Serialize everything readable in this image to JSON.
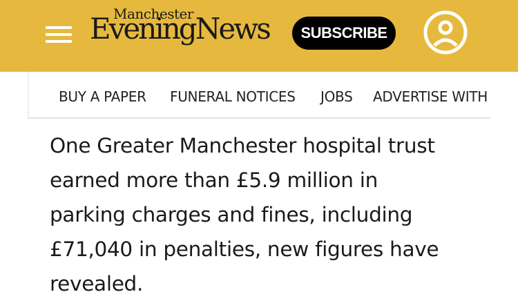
{
  "header": {
    "background_color": "#e6b93e",
    "menu_icon": "hamburger-menu-icon",
    "logo": {
      "top_text": "Manchester",
      "main_text": "EveningNews"
    },
    "subscribe_label": "SUBSCRIBE",
    "account_icon": "user-account-icon"
  },
  "nav": {
    "items": [
      {
        "label": "BUY A PAPER"
      },
      {
        "label": "FUNERAL NOTICES"
      },
      {
        "label": "JOBS"
      },
      {
        "label": "ADVERTISE WITH"
      }
    ]
  },
  "article": {
    "lines": [
      "One Greater Manchester hospital trust",
      "earned more than £5.9 million in",
      "parking charges and fines, including",
      "£71,040 in penalties, new figures have",
      "revealed."
    ]
  }
}
